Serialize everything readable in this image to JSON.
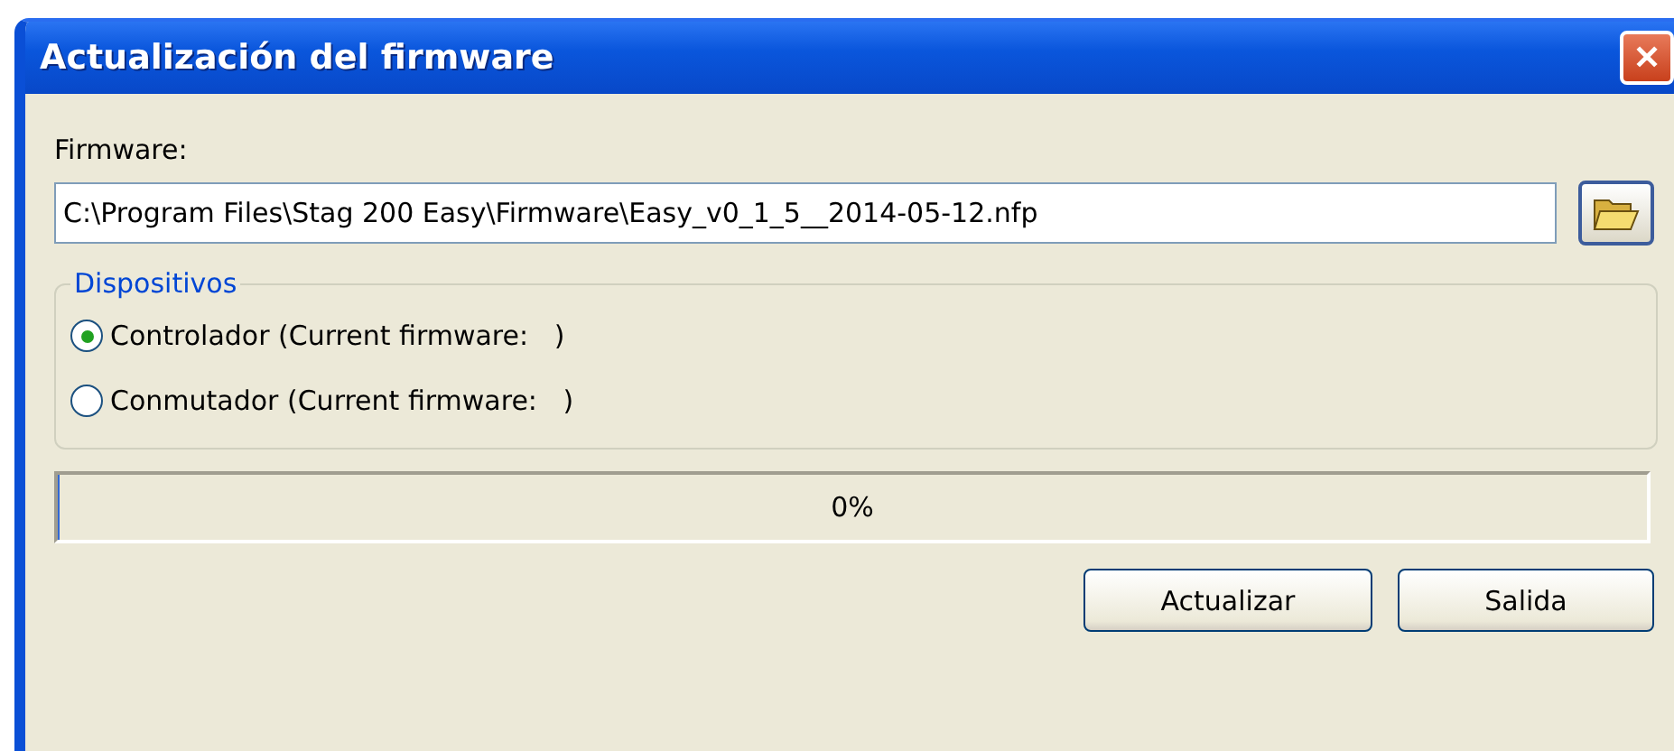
{
  "window": {
    "title": "Actualización del firmware",
    "close": "✕"
  },
  "firmware": {
    "label": "Firmware:",
    "value": "C:\\Program Files\\Stag 200 Easy\\Firmware\\Easy_v0_1_5__2014-05-12.nfp"
  },
  "devices": {
    "title": "Dispositivos",
    "options": [
      {
        "label": "Controlador (Current firmware:   )",
        "selected": true
      },
      {
        "label": "Conmutador (Current firmware:   )",
        "selected": false
      }
    ]
  },
  "progress": {
    "level": 0,
    "reading": "0%"
  },
  "buttons": [
    "Actualizar",
    "Salida"
  ]
}
